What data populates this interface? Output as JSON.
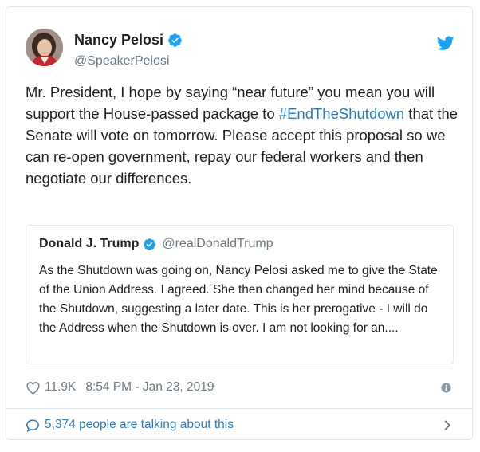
{
  "tweet": {
    "author": {
      "name": "Nancy Pelosi",
      "handle": "@SpeakerPelosi",
      "verified": true
    },
    "text_before_hashtag_1": "Mr. President, I hope by saying “near future” you mean you will support the House-passed package to ",
    "hashtag": "#EndTheShutdown",
    "text_after_hashtag": " that the Senate will vote on tomorrow. Please accept this proposal so we can re-open government, repay our federal workers and then negotiate our differences.",
    "quoted_tweet": {
      "author_name": "Donald J. Trump",
      "author_handle": "@realDonaldTrump",
      "verified": true,
      "text": "As the Shutdown was going on, Nancy Pelosi asked me to give the State of the Union Address. I agreed. She then changed her mind because of the Shutdown, suggesting a later date. This is her prerogative - I will do the Address when the Shutdown is over. I am not looking for an...."
    },
    "likes": "11.9K",
    "timestamp": "8:54 PM - Jan 23, 2019",
    "talking": "5,374 people are talking about this"
  },
  "icons": {
    "verified": "verified-badge-icon",
    "brand": "twitter-bird-icon",
    "like": "heart-icon",
    "info": "info-icon",
    "conversation": "speech-bubble-icon",
    "more": "chevron-right-icon"
  },
  "colors": {
    "link": "#2b7bb9",
    "verified": "#1da1f2",
    "muted": "#697882",
    "text": "#1c2022",
    "border": "#e1e8ed"
  }
}
